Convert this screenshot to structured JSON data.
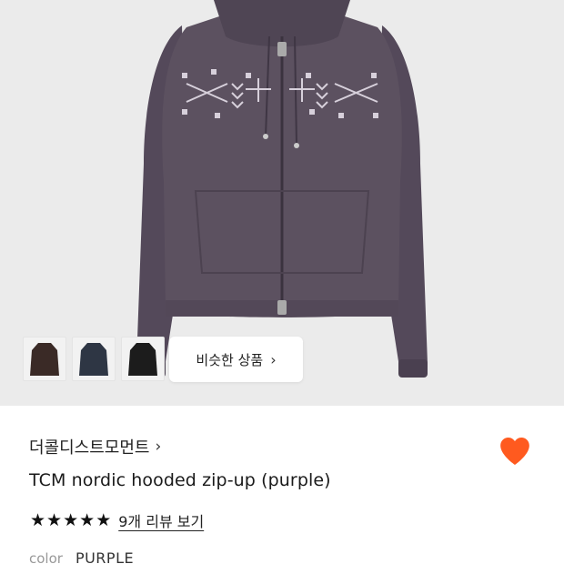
{
  "product": {
    "similar_products_label": "비슷한 상품",
    "brand": "더콜디스트모먼트",
    "title": "TCM nordic hooded zip-up (purple)",
    "rating": 5,
    "reviews_label": "9개 리뷰 보기",
    "color_label": "color",
    "color_value": "PURPLE",
    "thumbnails": [
      {
        "name": "brown hoodie",
        "color": "#3a2a26"
      },
      {
        "name": "navy hoodie",
        "color": "#2e3644"
      },
      {
        "name": "black hoodie",
        "color": "#1c1c1c"
      }
    ]
  },
  "colors": {
    "hoodie": "#5a4f5e",
    "heart": "#ff5a1f",
    "background": "#ebebeb"
  },
  "icons": {
    "chevron": "›",
    "star": "★"
  }
}
